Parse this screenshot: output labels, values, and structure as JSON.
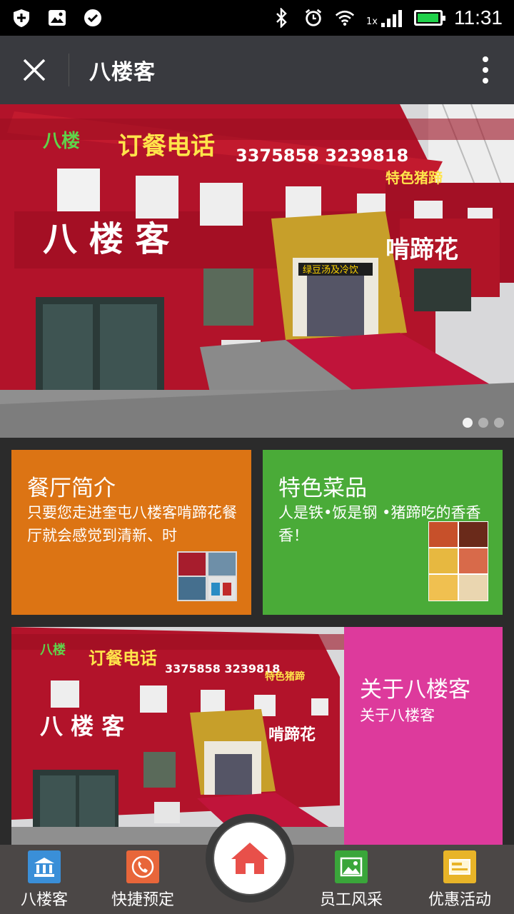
{
  "status_bar": {
    "time": "11:31",
    "network_label": "1x",
    "battery_level": 0.95
  },
  "title_bar": {
    "title": "八楼客"
  },
  "banner": {
    "slide_count": 3,
    "active_slide": 1
  },
  "tiles": [
    {
      "title": "餐厅简介",
      "desc": "只要您走进奎屯八楼客啃蹄花餐厅就会感觉到清新、时",
      "color": "#dc7414"
    },
    {
      "title": "特色菜品",
      "desc": "人是铁•饭是钢 •猪蹄吃的香香香！",
      "color": "#4aab38"
    },
    {
      "title": "关于八楼客",
      "desc": "关于八楼客",
      "color": "#dd3a9c"
    }
  ],
  "bottom_nav": {
    "items": [
      {
        "label": "八楼客",
        "icon": "bank-icon",
        "color": "#3a8fd8"
      },
      {
        "label": "快捷预定",
        "icon": "phone-icon",
        "color": "#e8663a"
      },
      {
        "label": "员工风采",
        "icon": "picture-icon",
        "color": "#3aa63a"
      },
      {
        "label": "优惠活动",
        "icon": "card-icon",
        "color": "#e8b428"
      }
    ],
    "home_icon": "home-icon"
  }
}
